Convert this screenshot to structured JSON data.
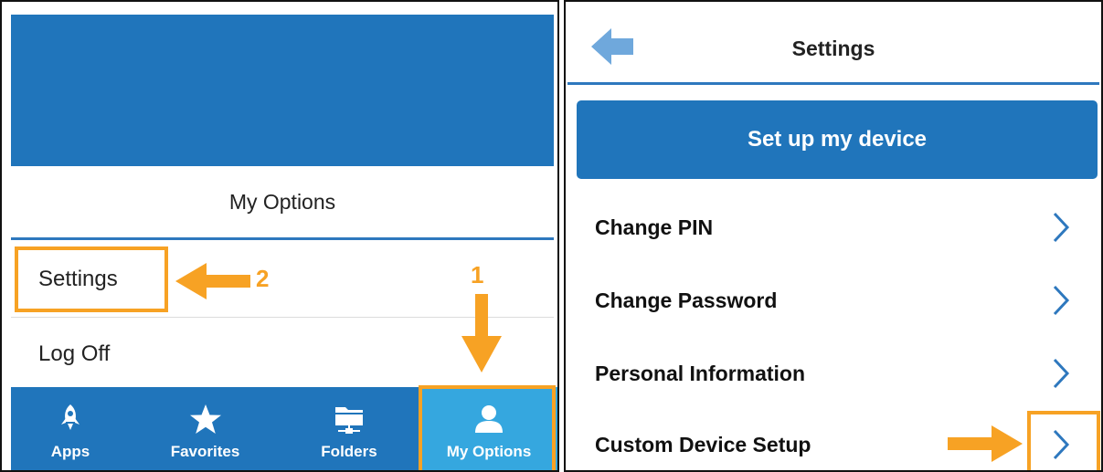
{
  "left": {
    "title": "My Options",
    "menu": [
      {
        "label": "Settings"
      },
      {
        "label": "Log Off"
      }
    ],
    "tabs": [
      {
        "label": "Apps",
        "icon": "rocket-icon"
      },
      {
        "label": "Favorites",
        "icon": "star-icon"
      },
      {
        "label": "Folders",
        "icon": "folder-icon"
      },
      {
        "label": "My Options",
        "icon": "user-icon",
        "active": true
      }
    ],
    "annotations": {
      "step1": "1",
      "step2": "2"
    }
  },
  "right": {
    "title": "Settings",
    "back_icon": "back-arrow-icon",
    "setup_button": "Set up my device",
    "items": [
      {
        "label": "Change PIN"
      },
      {
        "label": "Change Password"
      },
      {
        "label": "Personal Information"
      },
      {
        "label": "Custom Device Setup"
      }
    ]
  },
  "colors": {
    "primary_blue": "#2075bb",
    "active_tab_blue": "#35a7df",
    "highlight_orange": "#f7a224",
    "chevron_blue": "#2e78be"
  }
}
